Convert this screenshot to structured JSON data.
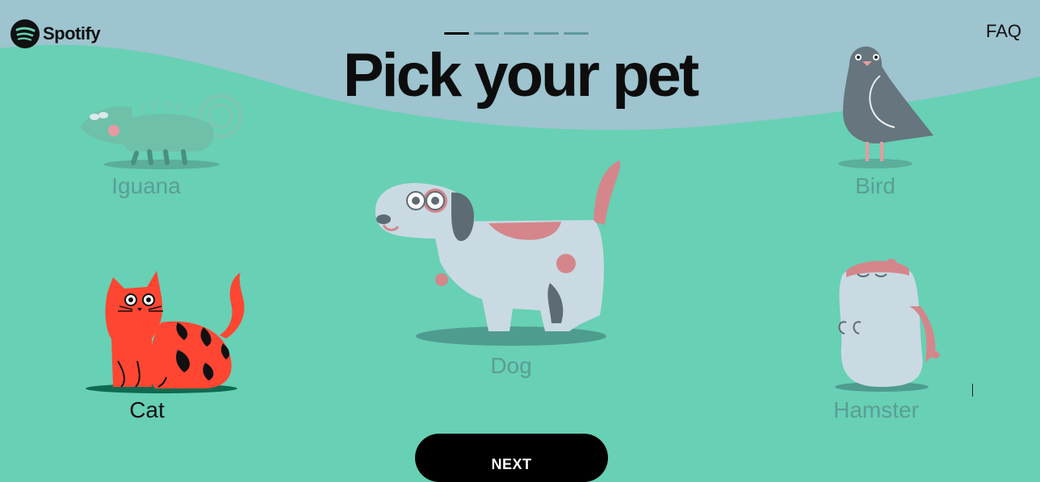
{
  "brand": {
    "name": "Spotify"
  },
  "nav": {
    "faq_label": "FAQ"
  },
  "progress": {
    "total_steps": 5,
    "current_step": 1
  },
  "page": {
    "title": "Pick your pet"
  },
  "pets": {
    "iguana": {
      "label": "Iguana",
      "selected": false
    },
    "bird": {
      "label": "Bird",
      "selected": false
    },
    "dog": {
      "label": "Dog",
      "selected": false
    },
    "cat": {
      "label": "Cat",
      "selected": true
    },
    "hamster": {
      "label": "Hamster",
      "selected": false
    }
  },
  "actions": {
    "next_label": "NEXT"
  },
  "colors": {
    "background": "#68d0b4",
    "sky": "#9dc4cf",
    "cat": "#ff4632",
    "text": "#111111",
    "dim_label": "#5a9e96"
  }
}
